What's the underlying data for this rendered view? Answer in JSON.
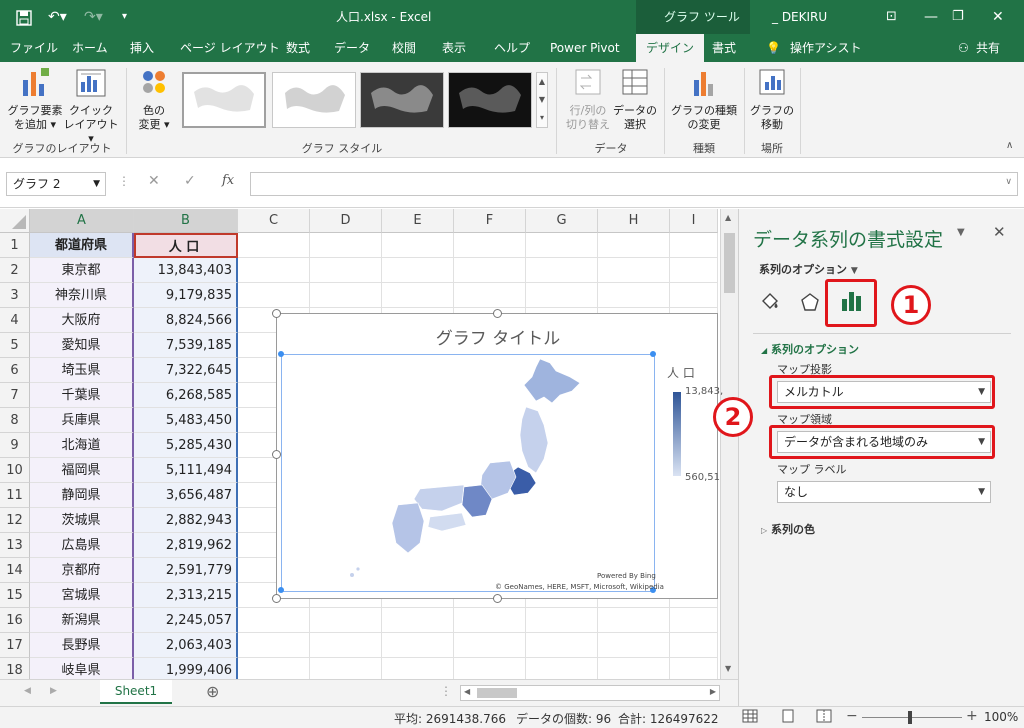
{
  "titlebar": {
    "filename": "人口.xlsx - Excel",
    "context_tab": "グラフ ツール",
    "user": "_ DEKIRU"
  },
  "tabs": [
    {
      "label": "ファイル"
    },
    {
      "label": "ホーム"
    },
    {
      "label": "挿入"
    },
    {
      "label": "ページ レイアウト"
    },
    {
      "label": "数式"
    },
    {
      "label": "データ"
    },
    {
      "label": "校閲"
    },
    {
      "label": "表示"
    },
    {
      "label": "ヘルプ"
    },
    {
      "label": "Power Pivot"
    },
    {
      "label": "デザイン"
    },
    {
      "label": "書式"
    },
    {
      "label": "操作アシスト"
    },
    {
      "label": "共有"
    }
  ],
  "ribbon": {
    "add_element": [
      "グラフ要素",
      "を追加"
    ],
    "quick_layout": [
      "クイック",
      "レイアウト"
    ],
    "group_layout": "グラフのレイアウト",
    "change_color": [
      "色の",
      "変更"
    ],
    "group_style": "グラフ スタイル",
    "switch_row_col": [
      "行/列の",
      "切り替え"
    ],
    "select_data": [
      "データの",
      "選択"
    ],
    "group_data": "データ",
    "change_type": [
      "グラフの種類",
      "の変更"
    ],
    "group_type": "種類",
    "move_chart": [
      "グラフの",
      "移動"
    ],
    "group_location": "場所"
  },
  "formula_bar": {
    "name_box": "グラフ 2",
    "fx": "fx"
  },
  "columns": [
    "A",
    "B",
    "C",
    "D",
    "E",
    "F",
    "G",
    "H",
    "I"
  ],
  "rows": [
    {
      "num": "1",
      "a": "都道府県",
      "b": "人 口"
    },
    {
      "num": "2",
      "a": "東京都",
      "b": "13,843,403"
    },
    {
      "num": "3",
      "a": "神奈川県",
      "b": "9,179,835"
    },
    {
      "num": "4",
      "a": "大阪府",
      "b": "8,824,566"
    },
    {
      "num": "5",
      "a": "愛知県",
      "b": "7,539,185"
    },
    {
      "num": "6",
      "a": "埼玉県",
      "b": "7,322,645"
    },
    {
      "num": "7",
      "a": "千葉県",
      "b": "6,268,585"
    },
    {
      "num": "8",
      "a": "兵庫県",
      "b": "5,483,450"
    },
    {
      "num": "9",
      "a": "北海道",
      "b": "5,285,430"
    },
    {
      "num": "10",
      "a": "福岡県",
      "b": "5,111,494"
    },
    {
      "num": "11",
      "a": "静岡県",
      "b": "3,656,487"
    },
    {
      "num": "12",
      "a": "茨城県",
      "b": "2,882,943"
    },
    {
      "num": "13",
      "a": "広島県",
      "b": "2,819,962"
    },
    {
      "num": "14",
      "a": "京都府",
      "b": "2,591,779"
    },
    {
      "num": "15",
      "a": "宮城県",
      "b": "2,313,215"
    },
    {
      "num": "16",
      "a": "新潟県",
      "b": "2,245,057"
    },
    {
      "num": "17",
      "a": "長野県",
      "b": "2,063,403"
    },
    {
      "num": "18",
      "a": "岐阜県",
      "b": "1,999,406"
    }
  ],
  "chart": {
    "title": "グラフ タイトル",
    "legend_title": "人 口",
    "legend_max": "13,843,",
    "legend_min": "560,51",
    "powered": "Powered By Bing",
    "credit": "© GeoNames, HERE, MSFT, Microsoft, Wikipedia"
  },
  "pane": {
    "title": "データ系列の書式設定",
    "options_dropdown": "系列のオプション",
    "section_title": "系列のオプション",
    "projection_label": "マップ投影",
    "projection_value": "メルカトル",
    "area_label": "マップ領域",
    "area_value": "データが含まれる地域のみ",
    "labels_label": "マップ ラベル",
    "labels_value": "なし",
    "series_color": "系列の色",
    "badge1": "1",
    "badge2": "2"
  },
  "sheet": {
    "tab": "Sheet1"
  },
  "status": {
    "average": "平均: 2691438.766",
    "count": "データの個数: 96",
    "sum": "合計: 126497622",
    "zoom": "100%"
  },
  "colors": {
    "excel_green": "#217346",
    "highlight_red": "#e0161b",
    "map_dark": "#2f5597",
    "map_light": "#dae3f3"
  }
}
